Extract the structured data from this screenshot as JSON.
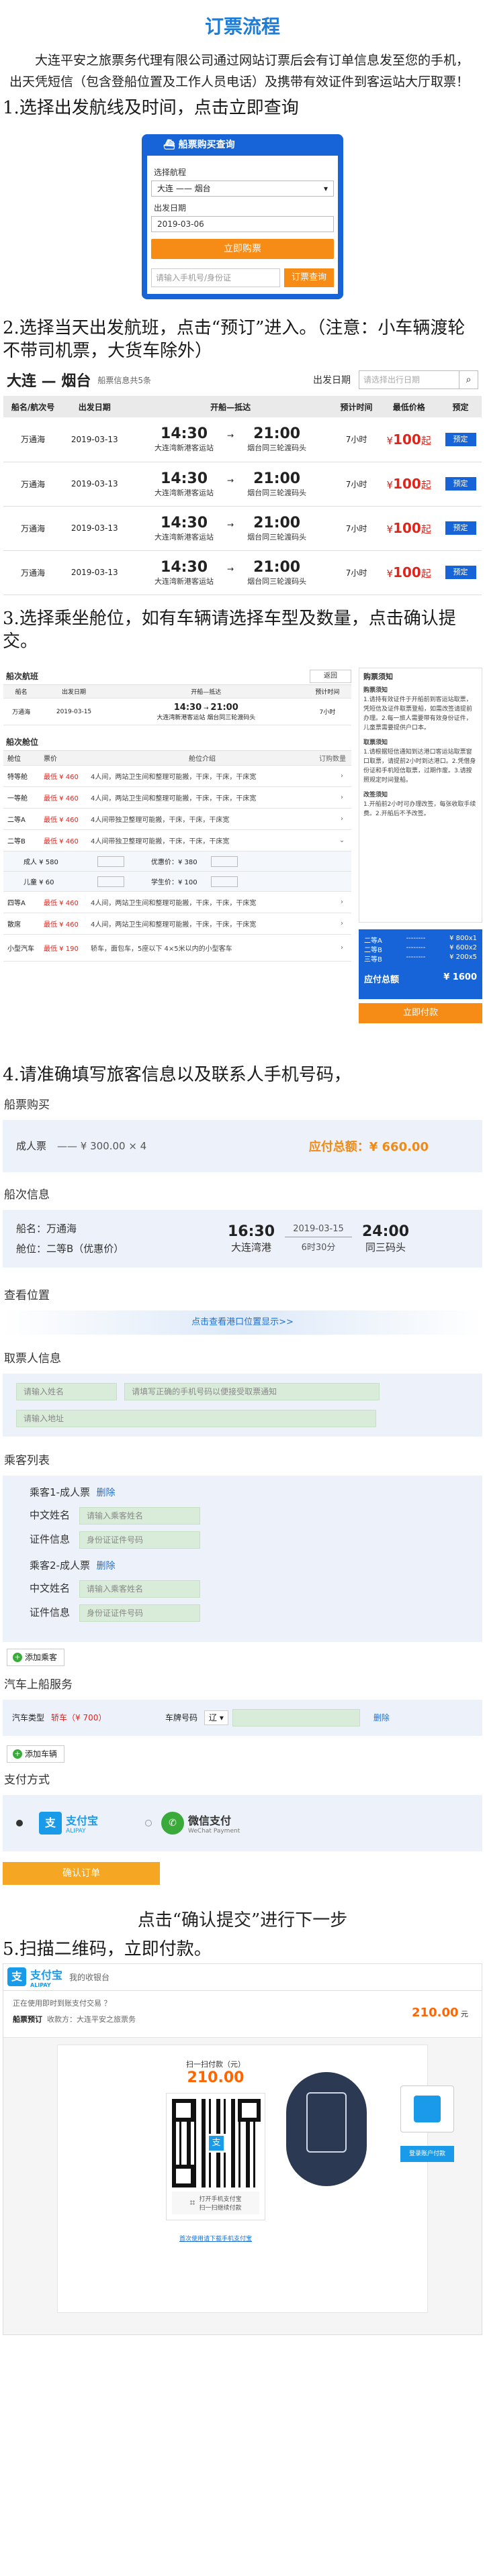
{
  "title": "订票流程",
  "intro": "大连平安之旅票务代理有限公司通过网站订票后会有订单信息发至您的手机，出天凭短信（包含登船位置及工作人员电话）及携带有效证件到客运站大厅取票！",
  "steps": {
    "s1": "1.选择出发航线及时间，点击立即查询",
    "s2": "2.选择当天出发航班，点击“预订”进入。（注意：小车辆渡轮不带司机票，大货车除外）",
    "s3": "3.选择乘坐舱位，如有车辆请选择车型及数量，点击确认提交。",
    "s4": "4.请准确填写旅客信息以及联系人手机号码，",
    "s5": "点击“确认提交”进行下一步",
    "s6": "5.扫描二维码，立即付款。"
  },
  "widget": {
    "header": "船票购买查询",
    "route_label": "选择航程",
    "route_value": "大连 —— 烟台",
    "date_label": "出发日期",
    "date_value": "2019-03-06",
    "buy_button": "立即购票",
    "phone_placeholder": "请输入手机号/身份证",
    "order_query_button": "订票查询"
  },
  "route": {
    "name": "大连 — 烟台",
    "sub": "船票信息共5条",
    "date_label": "出发日期",
    "date_placeholder": "请选择出行日期"
  },
  "trip_headers": [
    "船名/航次号",
    "出发日期",
    "开船—抵达",
    "预计时间",
    "最低价格",
    "预定"
  ],
  "trips": [
    {
      "ship": "万通海",
      "date": "2019-03-13",
      "dep": "14:30",
      "dep_port": "大连湾新港客运站",
      "arr": "21:00",
      "arr_port": "烟台同三轮渡码头",
      "dur": "7小时",
      "price": "100",
      "action": "预定"
    },
    {
      "ship": "万通海",
      "date": "2019-03-13",
      "dep": "14:30",
      "dep_port": "大连湾新港客运站",
      "arr": "21:00",
      "arr_port": "烟台同三轮渡码头",
      "dur": "7小时",
      "price": "100",
      "action": "预定"
    },
    {
      "ship": "万通海",
      "date": "2019-03-13",
      "dep": "14:30",
      "dep_port": "大连湾新港客运站",
      "arr": "21:00",
      "arr_port": "烟台同三轮渡码头",
      "dur": "7小时",
      "price": "100",
      "action": "预定"
    },
    {
      "ship": "万通海",
      "date": "2019-03-13",
      "dep": "14:30",
      "dep_port": "大连湾新港客运站",
      "arr": "21:00",
      "arr_port": "烟台同三轮渡码头",
      "dur": "7小时",
      "price": "100",
      "action": "预定"
    }
  ],
  "seat": {
    "info_title": "船次航班",
    "back": "返回",
    "info_headers": [
      "船名",
      "出发日期",
      "开船—抵达",
      "预计时间"
    ],
    "info_row": {
      "ship": "万通海",
      "date": "2019-03-15",
      "dep": "14:30",
      "dep_port": "大连湾新港客运站",
      "arr": "21:00",
      "arr_port": "烟台同三轮渡码头",
      "dur": "7小时"
    },
    "cabin_title": "船次舱位",
    "cabin_headers": [
      "舱位",
      "票价",
      "舱位介绍",
      "订购数量"
    ],
    "cabins": [
      {
        "name": "特等舱",
        "price": "最低 ¥ 460",
        "desc": "4人间，两站卫生间和整理可能搬，干床，干床，干床宽"
      },
      {
        "name": "一等舱",
        "price": "最低 ¥ 460",
        "desc": "4人间，两站卫生间和整理可能搬，干床，干床，干床宽"
      },
      {
        "name": "二等A",
        "price": "最低 ¥ 460",
        "desc": "4人间带独卫整理可能搬，干床，干床，干床宽"
      },
      {
        "name": "二等B",
        "price": "最低 ¥ 460",
        "desc": "4人间带独卫整理可能搬，干床，干床，干床宽"
      }
    ],
    "sub_rows": [
      {
        "label": "成人 ¥ 580",
        "label2": "优惠价：¥ 380"
      },
      {
        "label": "儿童 ¥ 60",
        "label2": "学生价：¥ 100"
      }
    ],
    "cabins2": [
      {
        "name": "四等A",
        "price": "最低 ¥ 460",
        "desc": "4人间，两站卫生间和整理可能搬，干床，干床，干床宽"
      },
      {
        "name": "散席",
        "price": "最低 ¥ 460",
        "desc": "4人间，两站卫生间和整理可能搬，干床，干床，干床宽"
      },
      {
        "name": "小型汽车",
        "price": "最低 ¥ 190",
        "desc": "轿车，面包车，5座以下 4×5米以内的小型客车"
      }
    ],
    "notice_title": "购票须知",
    "notice_h1": "购票须知",
    "notice_p1": "1.请持有效证件于开船前到客运站取票，凭短信及证件取票登船，如需改签请提前办理。2.每一旅人需要带有效身份证件，儿童票需要提供户口本。",
    "notice_h2": "取票须知",
    "notice_p2": "1.请根据短信通知到达港口客运站取票窗口取票，请提前2小时到达港口。2.凭借身份证和手机短信取票，过期作废。3.请按照规定时间登船。",
    "notice_h3": "改签须知",
    "notice_p3": "1.开船前2小时可办理改签，每张收取手续费。2.开船后不予改签。",
    "sum_lines": [
      {
        "name": "二等A",
        "dash": "--------",
        "val": "¥ 800x1"
      },
      {
        "name": "二等B",
        "dash": "--------",
        "val": "¥ 600x2"
      },
      {
        "name": "三等B",
        "dash": "--------",
        "val": "¥ 200x5"
      }
    ],
    "sum_label": "应付总额",
    "sum_value": "¥ 1600",
    "pay_button": "立即付款"
  },
  "order": {
    "sec1": "船票购买",
    "adult_label": "成人票",
    "adult_value": "—— ¥ 300.00 × 4",
    "total": "应付总额：¥ 660.00",
    "sec2": "船次信息",
    "ship_label": "船名：",
    "ship_value": "万通海",
    "cabin_label": "舱位：",
    "cabin_value": "二等B（优惠价）",
    "dep_time": "16:30",
    "dep_port": "大连湾港",
    "date": "2019-03-15",
    "duration": "6时30分",
    "arr_time": "24:00",
    "arr_port": "同三码头",
    "sec3": "查看位置",
    "location_link": "点击查看港口位置显示>>",
    "sec4": "取票人信息",
    "name_placeholder": "请输入姓名",
    "phone_placeholder": "请填写正确的手机号码以便接受取票通知",
    "addr_placeholder": "请输入地址",
    "sec5": "乘客列表",
    "p1_title": "乘客1-成人票",
    "p2_title": "乘客2-成人票",
    "delete": "删除",
    "name_label": "中文姓名",
    "name_input": "请输入乘客姓名",
    "id_label": "证件信息",
    "id_input": "身份证证件号码",
    "add_passenger": "添加乘客",
    "sec6": "汽车上船服务",
    "car_type_label": "汽车类型",
    "car_type_value": "轿车（¥ 700）",
    "plate_label": "车牌号码",
    "plate_prefix": "辽",
    "car_delete": "删除",
    "add_car": "添加车辆",
    "sec7": "支付方式",
    "alipay": "支付宝",
    "alipay_en": "ALIPAY",
    "wechat": "微信支付",
    "wechat_en": "WeChat Payment",
    "submit": "确认订单"
  },
  "alipay": {
    "brand": "支付宝",
    "brand_en": "ALIPAY",
    "sub": "我的收银台",
    "row1": "正在使用即时到账支付交易 ？",
    "row2_label": "船票预订",
    "row2_value": "收款方：大连平安之旅票务",
    "amount_top": "210.00",
    "amount_unit": "元",
    "scan_title": "扫一扫付款（元）",
    "amount": "210.00",
    "scan_hint1": "打开手机支付宝",
    "scan_hint2": "扫一扫继续付款",
    "download": "首次使用请下载手机支付宝",
    "login": "登录账户付款"
  }
}
